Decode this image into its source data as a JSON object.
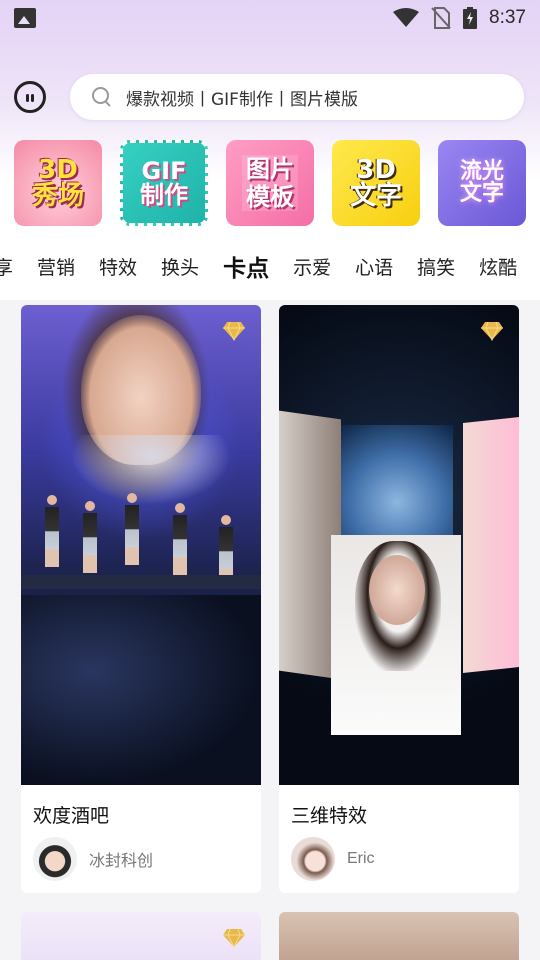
{
  "status_bar": {
    "time": "8:37",
    "icons": [
      "gallery-icon",
      "wifi-icon",
      "no-sim-icon",
      "battery-charging-icon"
    ]
  },
  "search": {
    "text": "爆款视频丨GIF制作丨图片模版",
    "icon": "search-icon"
  },
  "features": [
    {
      "label": "3D 秀场",
      "line1": "3D",
      "line2": "秀场"
    },
    {
      "label": "GIF 制作",
      "line1": "GIF",
      "line2": "制作"
    },
    {
      "label": "图片 模板",
      "line1": "图片",
      "line2": "模板"
    },
    {
      "label": "3D 文字",
      "line1": "3D",
      "line2": "文字"
    },
    {
      "label": "流光 文字",
      "line1": "流光",
      "line2": "文字"
    }
  ],
  "tabs": [
    "享",
    "营销",
    "特效",
    "换头",
    "卡点",
    "示爱",
    "心语",
    "搞笑",
    "炫酷"
  ],
  "active_tab": "卡点",
  "accent_color": "#ff3f6c",
  "cards": [
    {
      "title": "欢度酒吧",
      "author": "冰封科创",
      "vip": true
    },
    {
      "title": "三维特效",
      "author": "Eric",
      "vip": true
    },
    {
      "vip": true
    },
    {
      "vip": false
    }
  ]
}
